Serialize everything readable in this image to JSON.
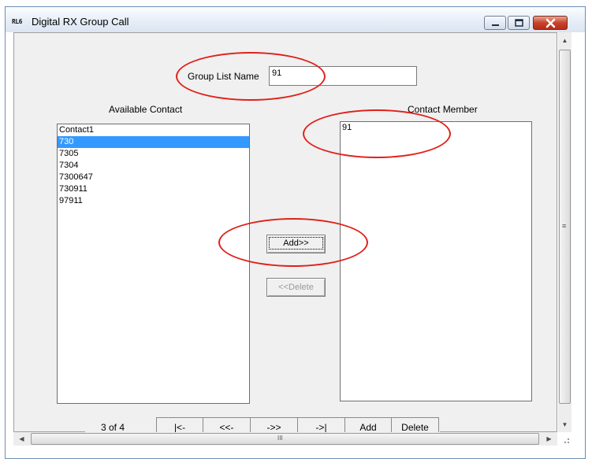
{
  "window": {
    "title": "Digital RX Group Call",
    "icon_text": "RL6",
    "buttons": {
      "minimize": "minimize-icon",
      "maximize": "maximize-icon",
      "close": "close-icon"
    }
  },
  "form": {
    "group_list_name_label": "Group List Name",
    "group_list_name_value": "91",
    "available_contact_label": "Available Contact",
    "contact_member_label": "Contact Member",
    "available_contacts": [
      "Contact1",
      "730",
      "7305",
      "7304",
      "7300647",
      "730911",
      "97911"
    ],
    "selected_available_index": 1,
    "contact_members": [
      "91"
    ],
    "add_button": "Add>>",
    "delete_button": "<<Delete"
  },
  "navigation": {
    "record_status": "3 of 4",
    "first": "|<-",
    "prev": "<<-",
    "next": "->>",
    "last": "->|",
    "add": "Add",
    "delete": "Delete"
  },
  "scrollbar": {
    "grip": "≡",
    "h_grip": "III"
  },
  "colors": {
    "selection": "#3399ff",
    "annotation": "#e0201a",
    "close_button": "#c7432d"
  }
}
